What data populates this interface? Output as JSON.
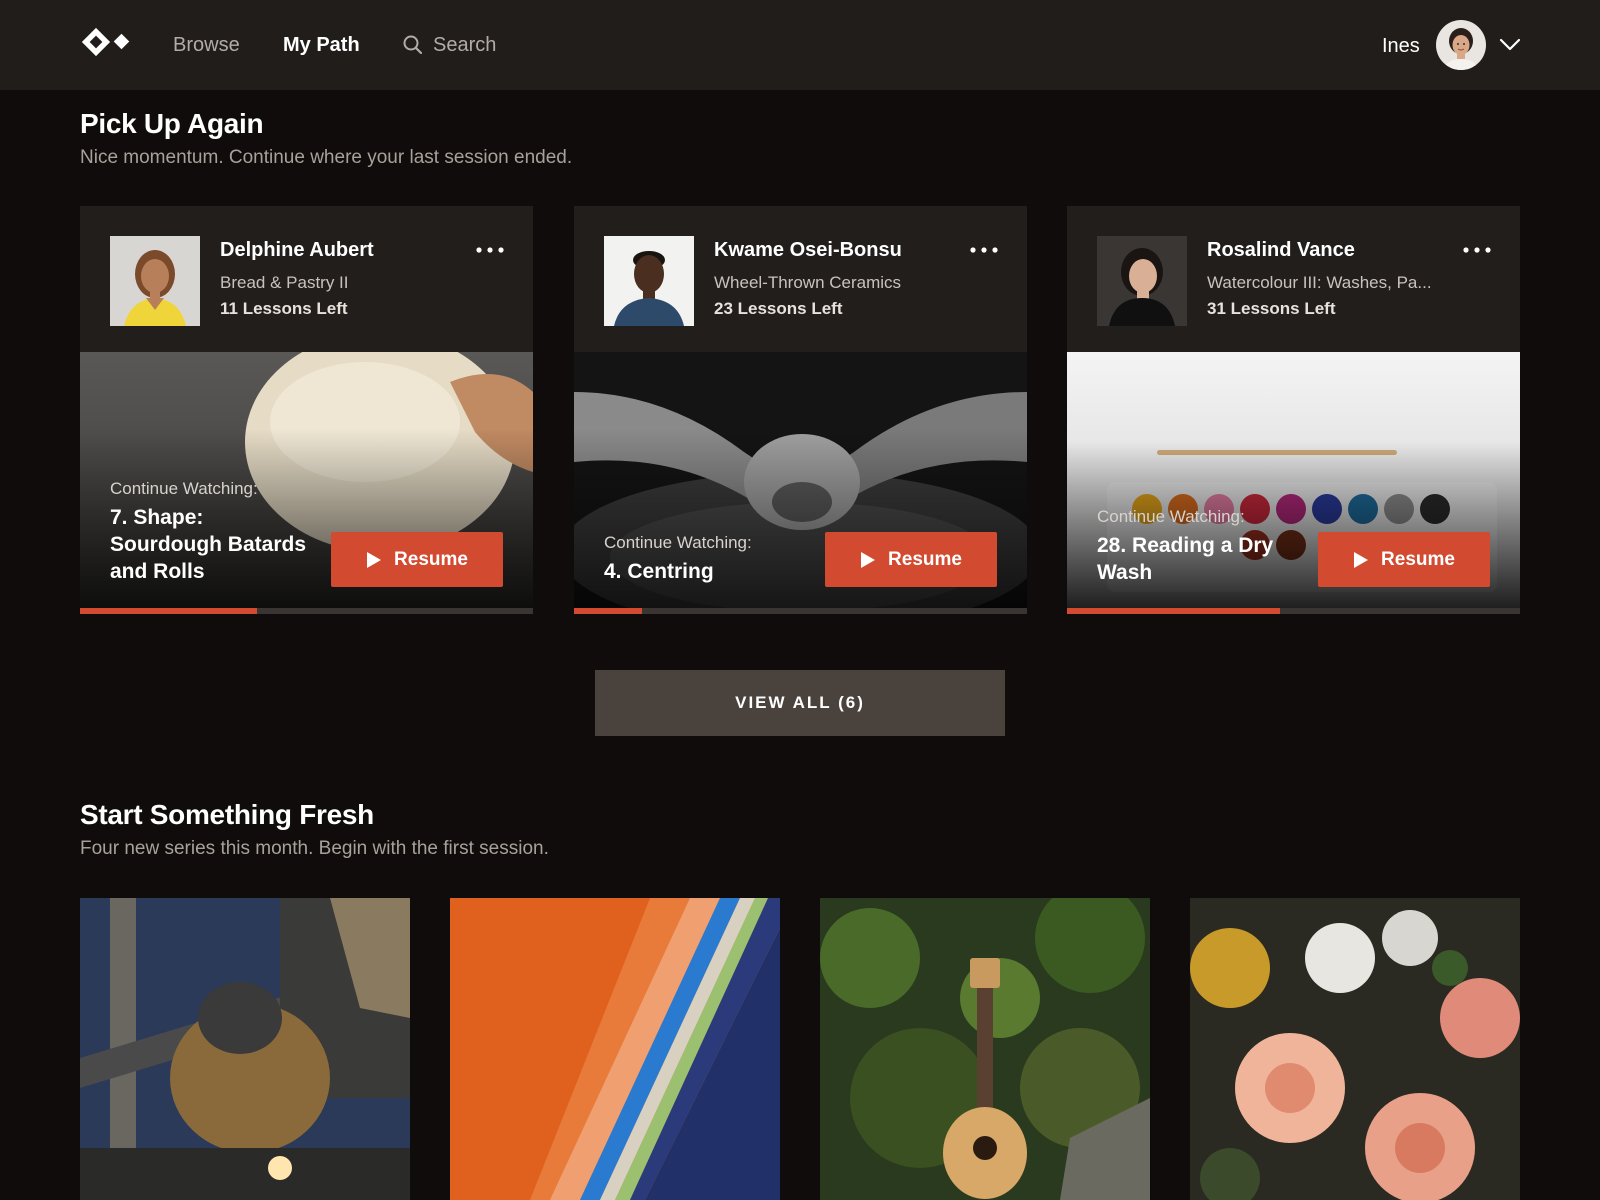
{
  "nav": {
    "links": [
      {
        "label": "Browse"
      },
      {
        "label": "My Path"
      }
    ],
    "search_label": "Search",
    "user_name": "Ines"
  },
  "pick_up": {
    "title": "Pick Up Again",
    "subtitle": "Nice momentum. Continue where your last session ended.",
    "cards": [
      {
        "instructor": "Delphine Aubert",
        "course": "Bread & Pastry II",
        "lessons_left": "11 Lessons Left",
        "continue_label": "Continue Watching:",
        "lesson_title": "7. Shape: Sourdough Batards and Rolls",
        "resume_label": "Resume",
        "progress": 0.39
      },
      {
        "instructor": "Kwame Osei-Bonsu",
        "course": "Wheel-Thrown Ceramics",
        "lessons_left": "23 Lessons Left",
        "continue_label": "Continue Watching:",
        "lesson_title": "4. Centring",
        "resume_label": "Resume",
        "progress": 0.15
      },
      {
        "instructor": "Rosalind Vance",
        "course": "Watercolour III: Washes, Pa...",
        "lessons_left": "31 Lessons Left",
        "continue_label": "Continue Watching:",
        "lesson_title": "28. Reading a Dry Wash",
        "resume_label": "Resume",
        "progress": 0.47
      }
    ],
    "view_all_label": "VIEW ALL (6)"
  },
  "fresh": {
    "title": "Start Something Fresh",
    "subtitle": "Four new series this month. Begin with the first session."
  },
  "colors": {
    "accent": "#d24a30",
    "nav_bg": "#201d1b",
    "page_bg": "#0f0c0b",
    "card_bg": "#221e1c"
  }
}
